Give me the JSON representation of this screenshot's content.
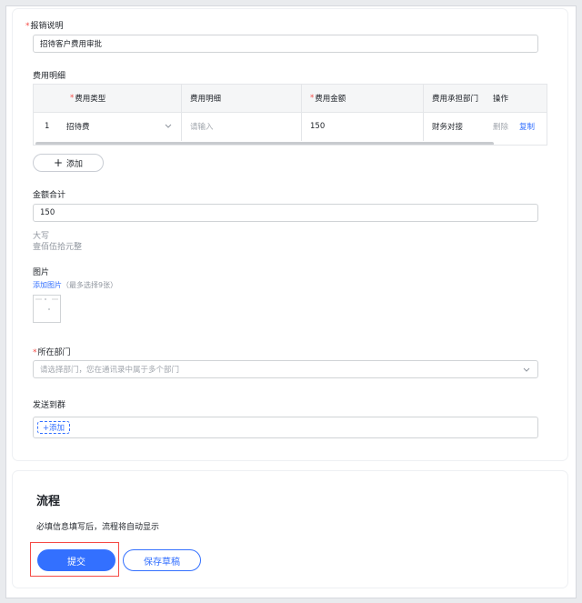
{
  "reason": {
    "label": "报销说明",
    "value": "招待客户费用审批"
  },
  "expense_detail": {
    "section_label": "费用明细",
    "columns": {
      "type": "费用类型",
      "detail": "费用明细",
      "amount": "费用金额",
      "dept": "费用承担部门",
      "ops": "操作"
    },
    "rows": [
      {
        "index": "1",
        "type": "招待费",
        "detail_placeholder": "请输入",
        "amount": "150",
        "dept": "财务对接",
        "delete": "删除",
        "copy": "复制"
      }
    ],
    "add_label": "添加"
  },
  "total": {
    "label": "金额合计",
    "value": "150",
    "uppercase_label": "大写",
    "uppercase_value": "壹佰伍拾元整"
  },
  "images": {
    "label": "图片",
    "add_link": "添加图片",
    "hint": "（最多选择9张）"
  },
  "department": {
    "label": "所在部门",
    "placeholder": "请选择部门，您在通讯录中属于多个部门"
  },
  "send_to_group": {
    "label": "发送到群",
    "add_label": "+添加"
  },
  "flow": {
    "title": "流程",
    "hint": "必填信息填写后，流程将自动显示"
  },
  "actions": {
    "submit": "提交",
    "save_draft": "保存草稿"
  },
  "colors": {
    "accent": "#3370ff",
    "required": "#f54a45"
  }
}
